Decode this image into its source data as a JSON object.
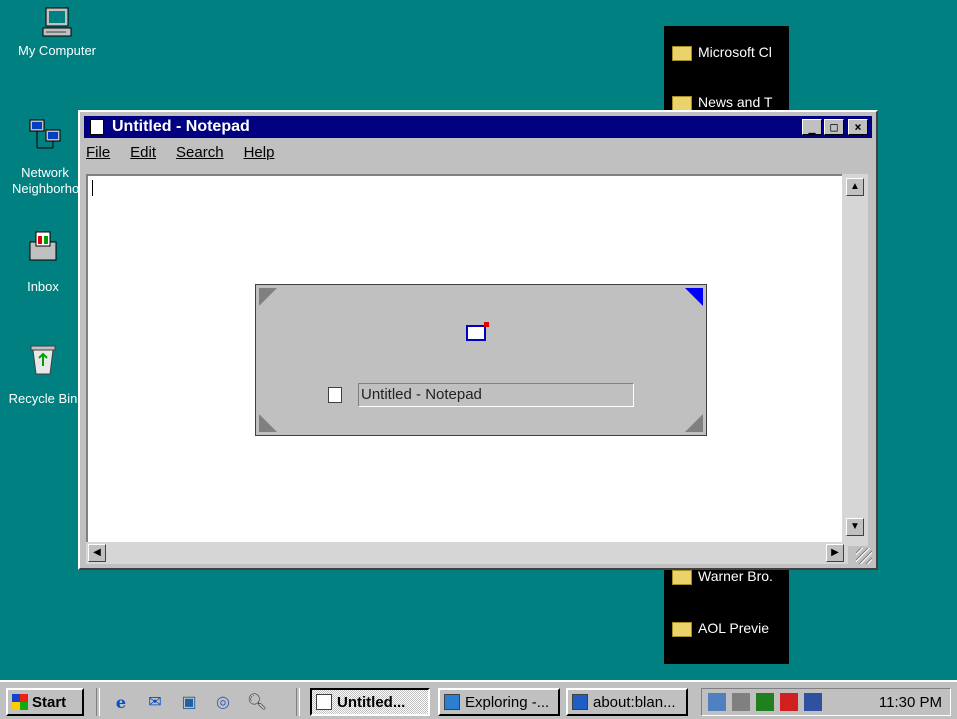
{
  "desktop": {
    "icons": [
      {
        "label": "My Computer"
      },
      {
        "label": "Network Neighborhood"
      },
      {
        "label": "Inbox"
      },
      {
        "label": "Recycle Bin"
      }
    ],
    "black_panel_items": [
      {
        "label": "Microsoft Cl"
      },
      {
        "label": "News and T"
      },
      {
        "label": "Warner Bro."
      },
      {
        "label": "AOL Previe"
      }
    ]
  },
  "notepad": {
    "title": "Untitled - Notepad",
    "controls": {
      "minimize": "_",
      "maximize": "□",
      "close": "×"
    },
    "menu": [
      "File",
      "Edit",
      "Search",
      "Help"
    ]
  },
  "task_switcher": {
    "label": "Untitled - Notepad"
  },
  "taskbar": {
    "start_label": "Start",
    "tasks": [
      {
        "label": "Untitled..."
      },
      {
        "label": "Exploring -..."
      },
      {
        "label": "about:blan..."
      }
    ],
    "clock": "11:30 PM"
  },
  "colors": {
    "desktop": "#008080",
    "titlebar": "#000080",
    "face": "#c0c0c0"
  }
}
